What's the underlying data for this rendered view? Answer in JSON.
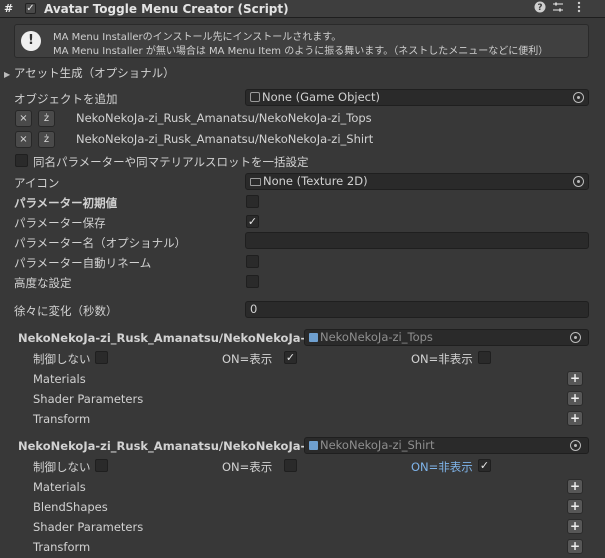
{
  "header": {
    "icon": "#",
    "title": "Avatar Toggle Menu Creator (Script)",
    "buttons": [
      "help-icon",
      "settings-sliders-icon",
      "kebab-menu-icon"
    ]
  },
  "help": {
    "line1": "MA Menu Installerのインストール先にインストールされます。",
    "line2": "MA Menu Installer が無い場合は MA Menu Item のように振る舞います。（ネストしたメニューなどに便利）"
  },
  "asset_foldout": "アセット生成（オプショナル）",
  "add_object": {
    "label": "オブジェクトを追加",
    "value": "None (Game Object)"
  },
  "objects": [
    {
      "path": "NekoNekoJa-zi_Rusk_Amanatsu/NekoNekoJa-zi_Tops"
    },
    {
      "path": "NekoNekoJa-zi_Rusk_Amanatsu/NekoNekoJa-zi_Shirt"
    }
  ],
  "bulk_setting_label": "同名パラメーターや同マテリアルスロットを一括設定",
  "icon_field": {
    "label": "アイコン",
    "value": "None (Texture 2D)"
  },
  "param_initial": {
    "label": "パラメーター初期値",
    "checked": false
  },
  "param_save": {
    "label": "パラメーター保存",
    "checked": true
  },
  "param_name": {
    "label": "パラメーター名（オプショナル）",
    "value": ""
  },
  "param_auto_rename": {
    "label": "パラメーター自動リネーム",
    "checked": false
  },
  "advanced": {
    "label": "高度な設定",
    "checked": false
  },
  "transition": {
    "label": "徐々に変化（秒数）",
    "value": "0"
  },
  "target_sections": [
    {
      "title": "NekoNekoJa-zi_Rusk_Amanatsu/NekoNekoJa-z",
      "object": "NekoNekoJa-zi_Tops",
      "no_control": "制御しない",
      "on_show": "ON=表示",
      "on_hide": "ON=非表示",
      "no_control_checked": false,
      "on_show_checked": true,
      "on_hide_checked": false,
      "rows": [
        "Materials",
        "Shader Parameters",
        "Transform"
      ]
    },
    {
      "title": "NekoNekoJa-zi_Rusk_Amanatsu/NekoNekoJa-z",
      "object": "NekoNekoJa-zi_Shirt",
      "no_control": "制御しない",
      "on_show": "ON=表示",
      "on_hide": "ON=非表示",
      "no_control_checked": false,
      "on_show_checked": false,
      "on_hide_checked": true,
      "rows": [
        "Materials",
        "BlendShapes",
        "Shader Parameters",
        "Transform"
      ]
    }
  ],
  "symbols": {
    "check": "✓",
    "remove": "×",
    "edit": "ż",
    "plus": "+"
  }
}
